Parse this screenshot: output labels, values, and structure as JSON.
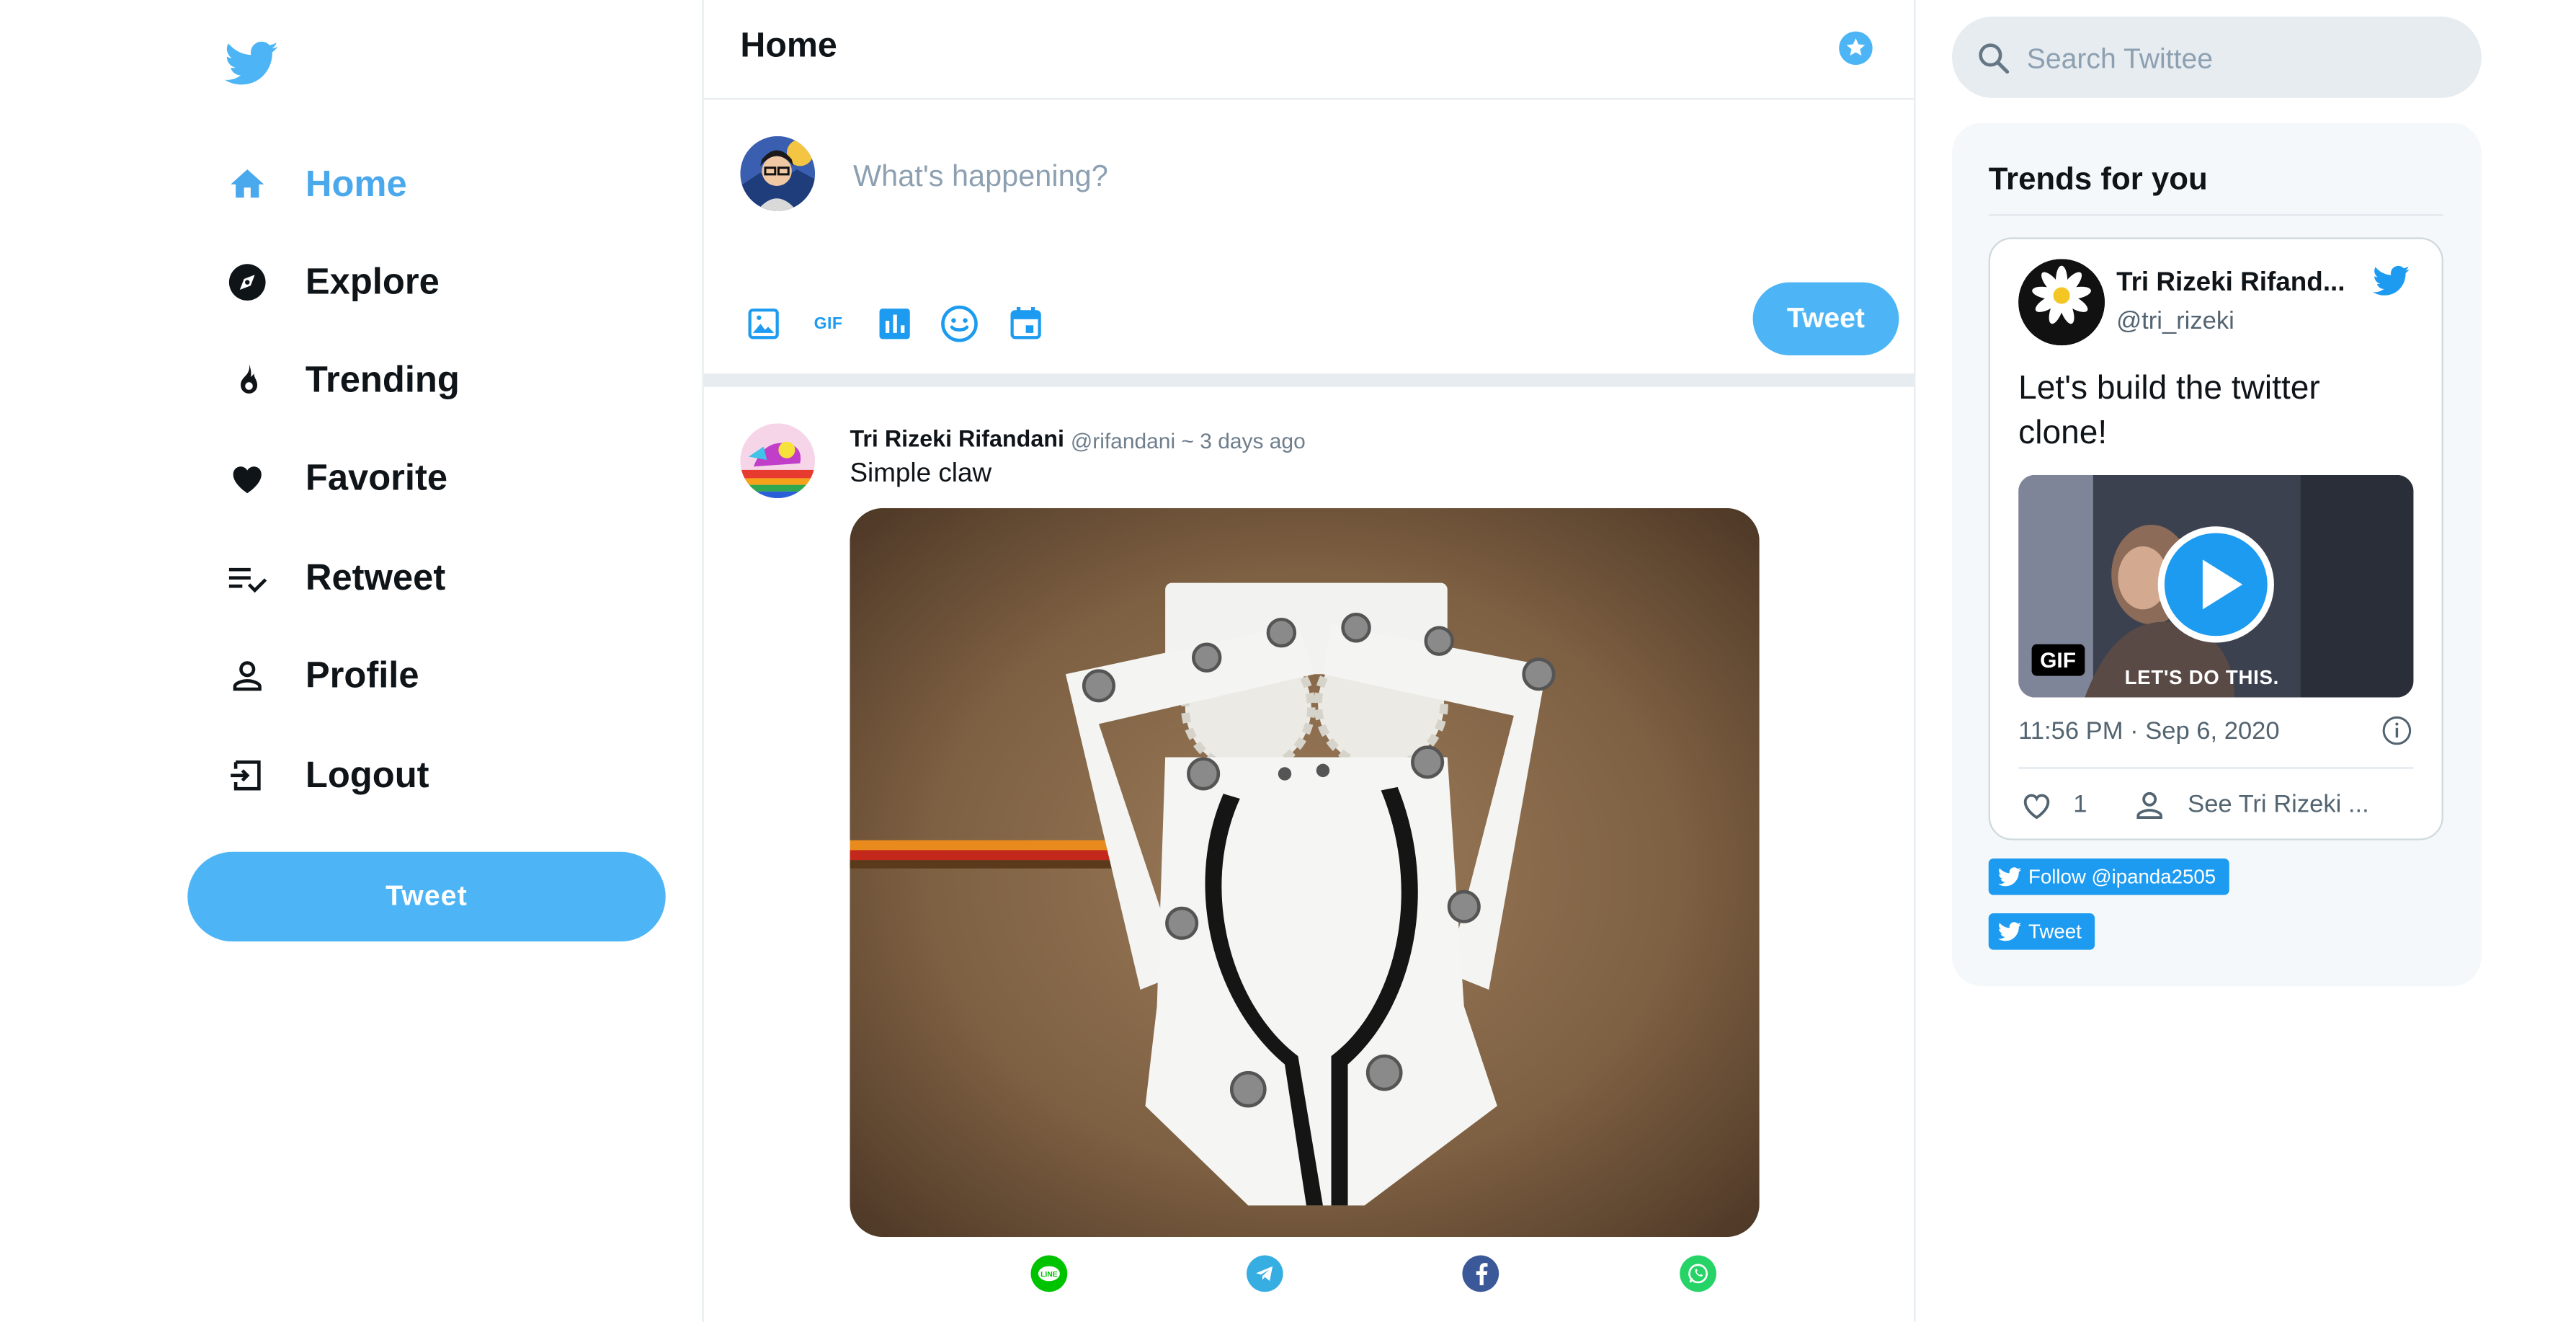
{
  "sidebar": {
    "logo_icon": "twitter-bird-icon",
    "items": [
      {
        "label": "Home",
        "icon": "home-icon",
        "active": true
      },
      {
        "label": "Explore",
        "icon": "compass-icon"
      },
      {
        "label": "Trending",
        "icon": "flame-icon"
      },
      {
        "label": "Favorite",
        "icon": "heart-icon"
      },
      {
        "label": "Retweet",
        "icon": "list-check-icon"
      },
      {
        "label": "Profile",
        "icon": "person-icon"
      },
      {
        "label": "Logout",
        "icon": "logout-icon"
      }
    ],
    "tweet_button": "Tweet"
  },
  "main": {
    "title": "Home",
    "compose": {
      "placeholder": "What's happening?",
      "toolbar_icons": [
        "image-icon",
        "gif-icon",
        "poll-icon",
        "emoji-icon",
        "schedule-icon"
      ],
      "gif_label": "GIF",
      "tweet_button": "Tweet"
    },
    "tweet": {
      "author": "Tri Rizeki Rifandani",
      "meta": "@rifandani ~ 3 days ago",
      "text": "Simple claw",
      "share_icons": [
        "line-icon",
        "telegram-icon",
        "facebook-icon",
        "whatsapp-icon"
      ]
    }
  },
  "right": {
    "search_placeholder": "Search Twittee",
    "trends_title": "Trends for you",
    "embed": {
      "name": "Tri Rizeki Rifand...",
      "handle": "@tri_rizeki",
      "text": "Let's build the twitter clone!",
      "gif_badge": "GIF",
      "caption": "LET'S DO THIS.",
      "time": "11:56 PM · Sep 6, 2020",
      "likes": "1",
      "see_more": "See Tri Rizeki ..."
    },
    "follow_button": "Follow @ipanda2505",
    "tweet_button": "Tweet"
  },
  "colors": {
    "accent": "#4db5f5",
    "link_blue": "#1d9bf0",
    "active_nav": "#4aa8ec"
  }
}
